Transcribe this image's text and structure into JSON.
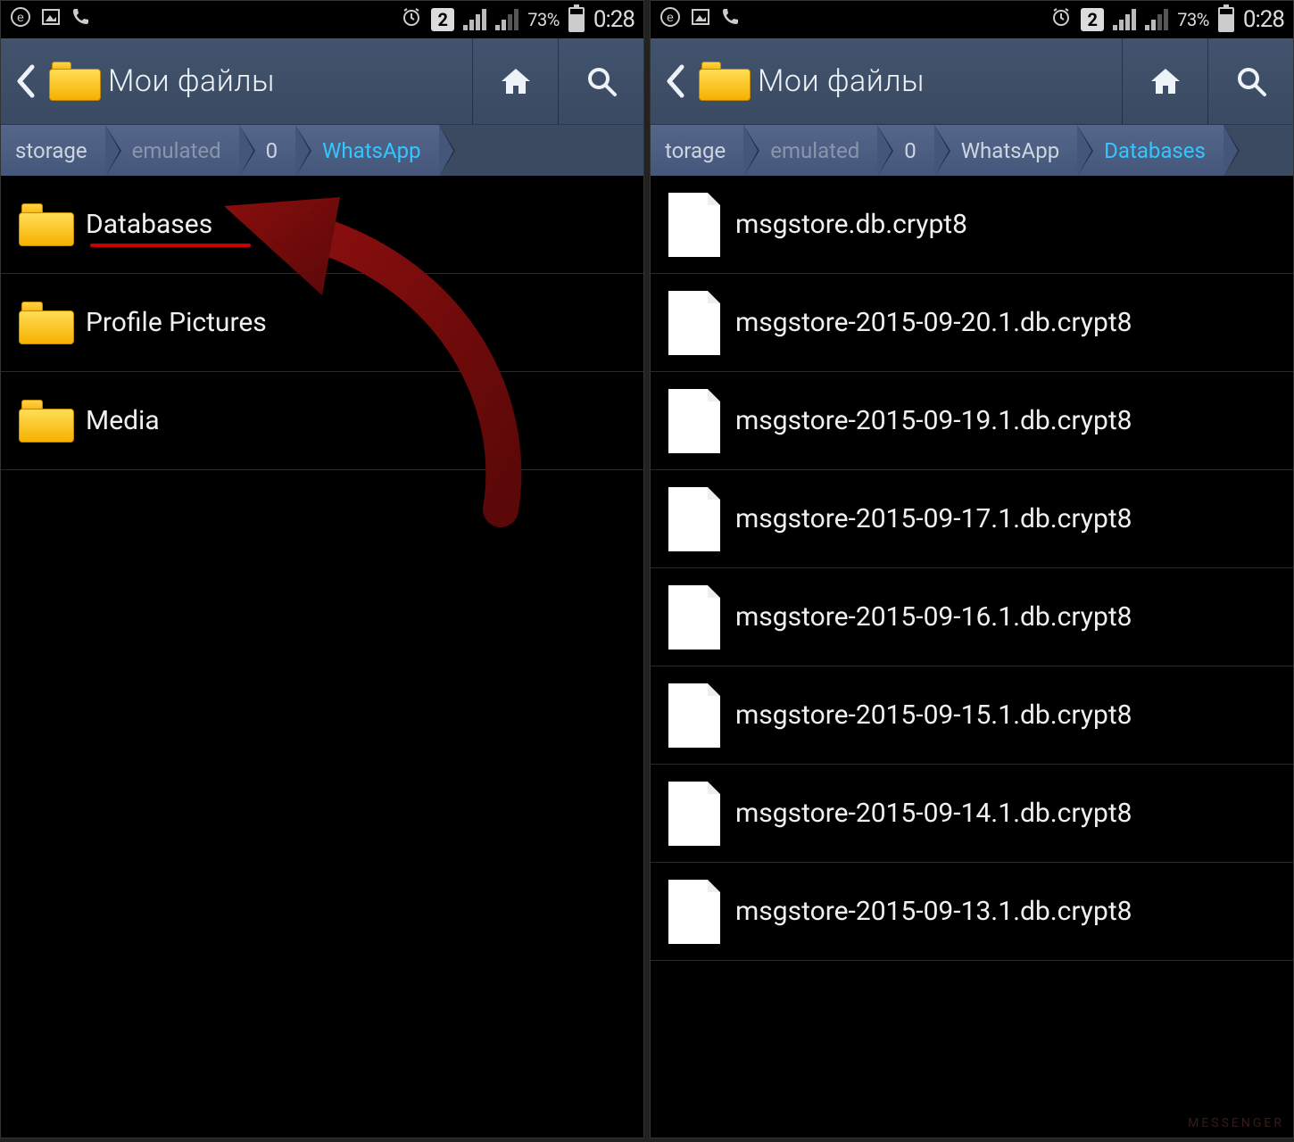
{
  "status": {
    "battery_percent": "73%",
    "clock": "0:28",
    "sim_badge": "2"
  },
  "app": {
    "title": "Мои файлы"
  },
  "left": {
    "breadcrumb": [
      {
        "label": "storage",
        "dim": false,
        "active": false
      },
      {
        "label": "emulated",
        "dim": true,
        "active": false
      },
      {
        "label": "0",
        "dim": false,
        "active": false
      },
      {
        "label": "WhatsApp",
        "dim": false,
        "active": true
      }
    ],
    "items": [
      {
        "type": "folder",
        "name": "Databases",
        "highlight": true
      },
      {
        "type": "folder",
        "name": "Profile Pictures",
        "highlight": false
      },
      {
        "type": "folder",
        "name": "Media",
        "highlight": false
      }
    ]
  },
  "right": {
    "breadcrumb": [
      {
        "label": "torage",
        "dim": false,
        "active": false
      },
      {
        "label": "emulated",
        "dim": true,
        "active": false
      },
      {
        "label": "0",
        "dim": false,
        "active": false
      },
      {
        "label": "WhatsApp",
        "dim": false,
        "active": false
      },
      {
        "label": "Databases",
        "dim": false,
        "active": true
      }
    ],
    "items": [
      {
        "type": "file",
        "name": "msgstore.db.crypt8"
      },
      {
        "type": "file",
        "name": "msgstore-2015-09-20.1.db.crypt8"
      },
      {
        "type": "file",
        "name": "msgstore-2015-09-19.1.db.crypt8"
      },
      {
        "type": "file",
        "name": "msgstore-2015-09-17.1.db.crypt8"
      },
      {
        "type": "file",
        "name": "msgstore-2015-09-16.1.db.crypt8"
      },
      {
        "type": "file",
        "name": "msgstore-2015-09-15.1.db.crypt8"
      },
      {
        "type": "file",
        "name": "msgstore-2015-09-14.1.db.crypt8"
      },
      {
        "type": "file",
        "name": "msgstore-2015-09-13.1.db.crypt8"
      }
    ]
  },
  "watermark": "MESSENGER"
}
